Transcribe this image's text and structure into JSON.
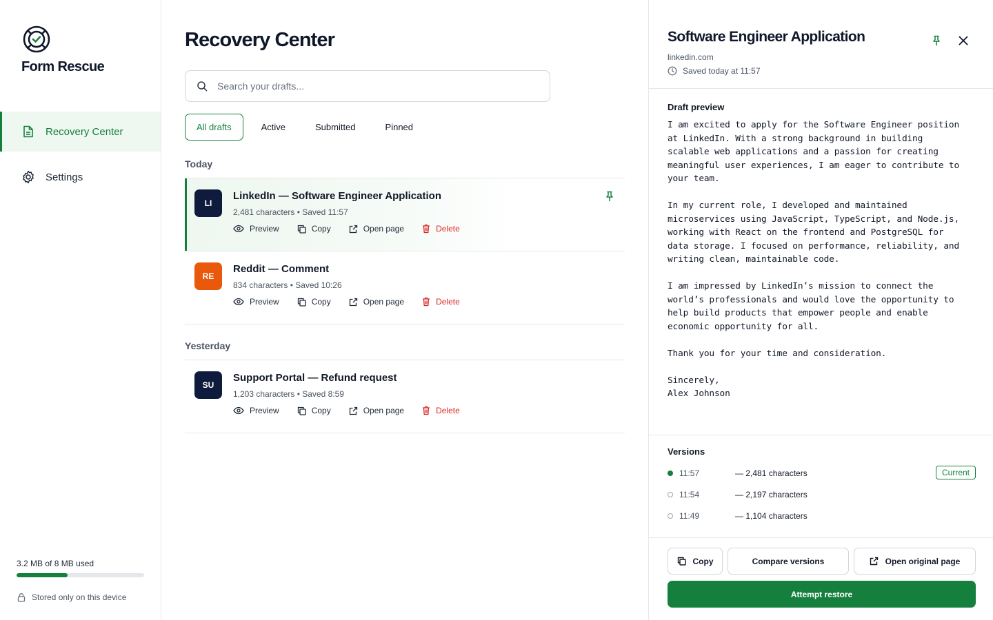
{
  "app": {
    "brand": "Form Rescue"
  },
  "sidebar": {
    "items": [
      {
        "label": "Recovery Center",
        "icon": "document-icon",
        "active": true
      },
      {
        "label": "Settings",
        "icon": "gear-icon",
        "active": false
      }
    ],
    "storage": {
      "text": "3.2 MB of 8 MB used",
      "used_fraction": 0.4
    },
    "privacy_note": "Stored only on this device"
  },
  "main": {
    "title": "Recovery Center",
    "search": {
      "placeholder": "Search your drafts...",
      "value": ""
    },
    "tabs": [
      {
        "label": "All drafts",
        "active": true
      },
      {
        "label": "Active"
      },
      {
        "label": "Submitted"
      },
      {
        "label": "Pinned"
      }
    ],
    "actions": {
      "preview": "Preview",
      "copy": "Copy",
      "open": "Open page",
      "delete": "Delete"
    },
    "groups": [
      {
        "label": "Today",
        "drafts": [
          {
            "initials": "LI",
            "color": "#0f1b3d",
            "title": "LinkedIn — Software Engineer Application",
            "meta": "2,481 characters • Saved 11:57",
            "pinned": true,
            "selected": true
          },
          {
            "initials": "RE",
            "color": "#ea580c",
            "title": "Reddit — Comment",
            "meta": "834 characters • Saved 10:26",
            "pinned": false,
            "selected": false
          }
        ]
      },
      {
        "label": "Yesterday",
        "drafts": [
          {
            "initials": "SU",
            "color": "#0f1b3d",
            "title": "Support Portal — Refund request",
            "meta": "1,203 characters • Saved 8:59",
            "pinned": false,
            "selected": false
          }
        ]
      }
    ]
  },
  "detail": {
    "title": "Software Engineer Application",
    "domain": "linkedin.com",
    "saved": "Saved today at 11:57",
    "preview_heading": "Draft preview",
    "preview_text": "I am excited to apply for the Software Engineer position\nat LinkedIn. With a strong background in building\nscalable web applications and a passion for creating\nmeaningful user experiences, I am eager to contribute to\nyour team.\n\nIn my current role, I developed and maintained\nmicroservices using JavaScript, TypeScript, and Node.js,\nworking with React on the frontend and PostgreSQL for\ndata storage. I focused on performance, reliability, and\nwriting clean, maintainable code.\n\nI am impressed by LinkedIn’s mission to connect the\nworld’s professionals and would love the opportunity to\nhelp build products that empower people and enable\neconomic opportunity for all.\n\nThank you for your time and consideration.\n\nSincerely,\nAlex Johnson",
    "versions_heading": "Versions",
    "versions": [
      {
        "time": "11:57",
        "chars": "— 2,481 characters",
        "current": true,
        "badge": "Current"
      },
      {
        "time": "11:54",
        "chars": "— 2,197 characters",
        "current": false
      },
      {
        "time": "11:49",
        "chars": "— 1,104 characters",
        "current": false
      }
    ],
    "buttons": {
      "copy": "Copy",
      "compare": "Compare versions",
      "open_original": "Open original page",
      "restore": "Attempt restore"
    }
  },
  "colors": {
    "accent": "#15803d",
    "delete": "#dc2626",
    "avatar_dark": "#0f1b3d",
    "avatar_orange": "#ea580c"
  }
}
